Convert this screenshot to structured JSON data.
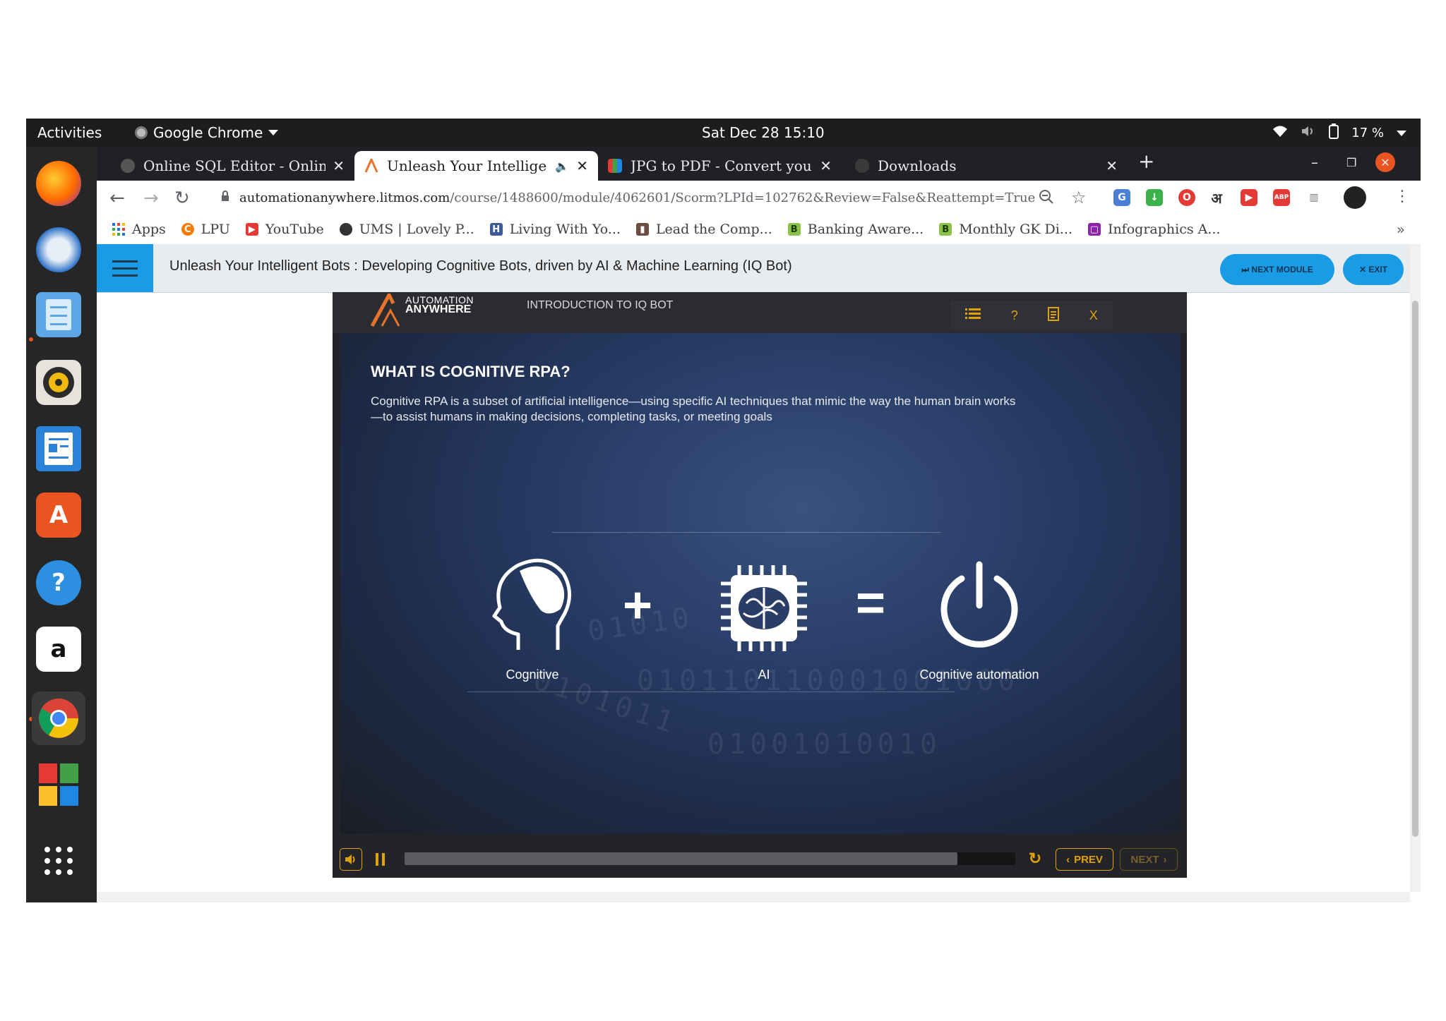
{
  "system": {
    "activities": "Activities",
    "app_name": "Google Chrome",
    "clock": "Sat Dec 28  15:10",
    "battery": "17 %"
  },
  "tabs": [
    {
      "title": "Online SQL Editor - Onlin",
      "active": false
    },
    {
      "title": "Unleash Your Intellige",
      "active": true
    },
    {
      "title": "JPG to PDF - Convert you",
      "active": false
    },
    {
      "title": "Downloads",
      "active": false
    }
  ],
  "address_bar": {
    "domain": "automationanywhere.litmos.com",
    "path": "/course/1488600/module/4062601/Scorm?LPId=102762&Review=False&Reattempt=True"
  },
  "bookmarks": [
    {
      "label": "Apps",
      "icon": "apps-grid-icon"
    },
    {
      "label": "LPU",
      "icon": "lpu-icon"
    },
    {
      "label": "YouTube",
      "icon": "youtube-icon"
    },
    {
      "label": "UMS | Lovely P...",
      "icon": "ums-icon"
    },
    {
      "label": "Living With Yo...",
      "icon": "living-icon"
    },
    {
      "label": "Lead the Comp...",
      "icon": "lead-icon"
    },
    {
      "label": "Banking Aware...",
      "icon": "b-icon"
    },
    {
      "label": "Monthly GK Di...",
      "icon": "b-icon"
    },
    {
      "label": "Infographics A...",
      "icon": "infographics-icon"
    }
  ],
  "lms": {
    "course_title": "Unleash Your Intelligent Bots : Developing Cognitive Bots, driven by AI & Machine Learning (IQ Bot)",
    "next_module": "⏭ NEXT MODULE",
    "exit": "✕ EXIT"
  },
  "player": {
    "logo_line1": "AUTOMATION",
    "logo_line2": "ANYWHERE",
    "module_title": "INTRODUCTION TO IQ BOT",
    "tool_close": "X",
    "tool_help": "?",
    "slide": {
      "heading": "WHAT IS COGNITIVE RPA?",
      "body": "Cognitive RPA is a subset of artificial intelligence—using specific AI techniques that mimic the way the human brain works—to assist humans in making decisions, completing tasks, or meeting goals",
      "plus": "+",
      "equals": "=",
      "captions": [
        "Cognitive",
        "AI",
        "Cognitive automation"
      ]
    },
    "progress": 0.905,
    "prev": "PREV",
    "next": "NEXT"
  },
  "colors": {
    "accent_blue": "#1a9be6",
    "player_gold": "#e0a10b"
  }
}
